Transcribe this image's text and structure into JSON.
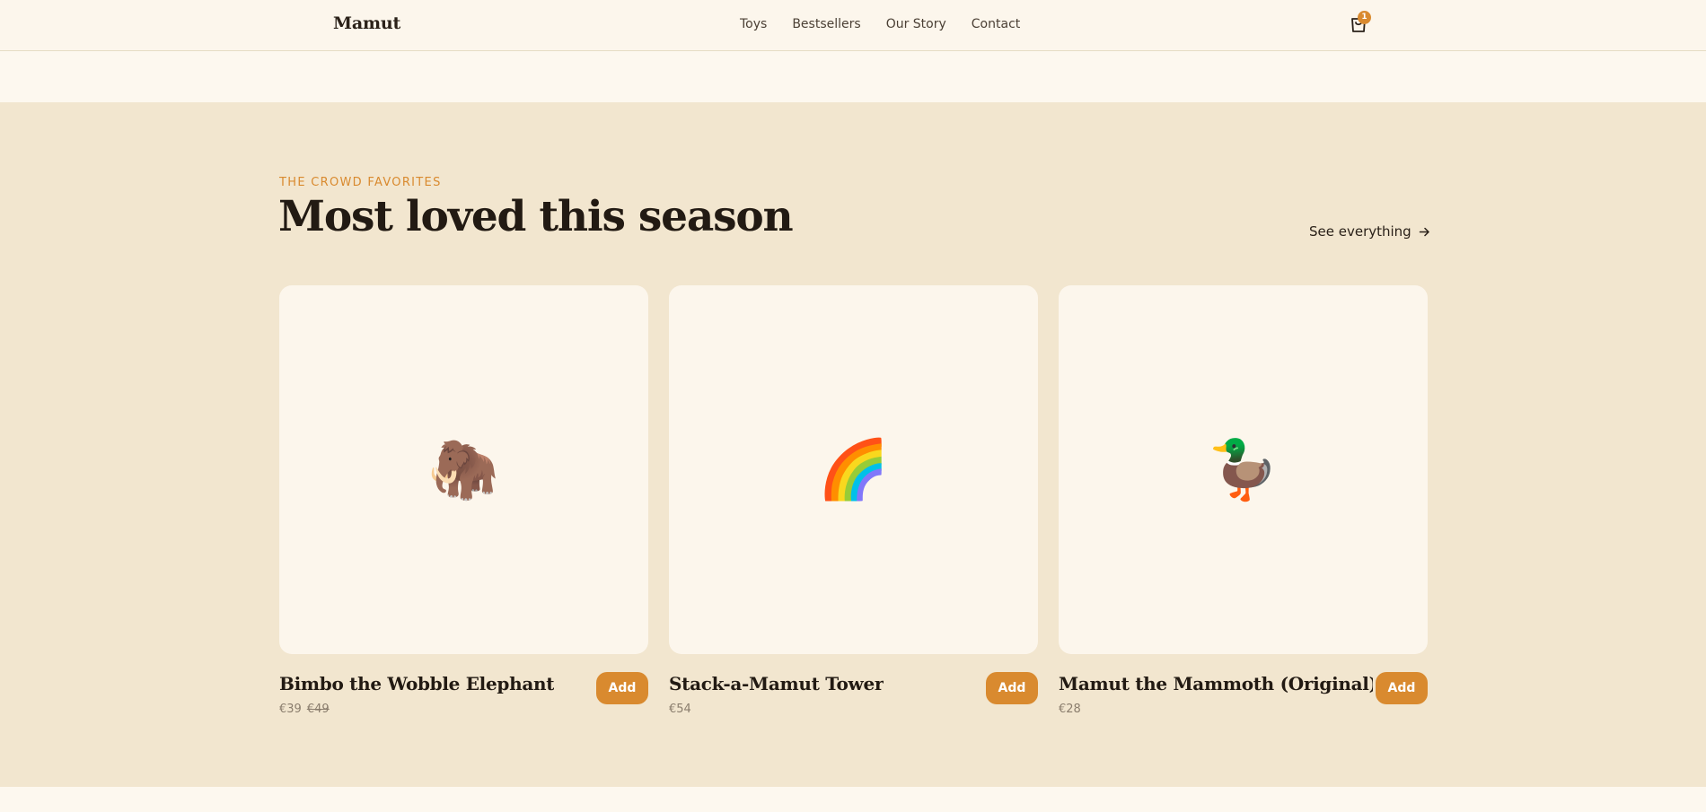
{
  "header": {
    "logo": "Mamut",
    "nav": [
      "Toys",
      "Bestsellers",
      "Our Story",
      "Contact"
    ],
    "cart_count": "1"
  },
  "section": {
    "eyebrow": "THE CROWD FAVORITES",
    "title": "Most loved this season",
    "see_all": "See everything",
    "see_all_icon": "arrow-right-icon"
  },
  "products": [
    {
      "name": "Bimbo the Wobble Elephant",
      "price": "€39",
      "old_price": "€49",
      "image": "🦣",
      "button": "Add"
    },
    {
      "name": "Stack-a-Mamut Tower",
      "price": "€54",
      "old_price": "",
      "image": "🌈",
      "button": "Add"
    },
    {
      "name": "Mamut the Mammoth (Original)",
      "price": "€28",
      "old_price": "",
      "image": "🦆",
      "button": "Add"
    }
  ],
  "colors": {
    "accent": "#d98a2f",
    "section_bg": "#f2e6cf",
    "page_bg": "#fdf8ef"
  }
}
